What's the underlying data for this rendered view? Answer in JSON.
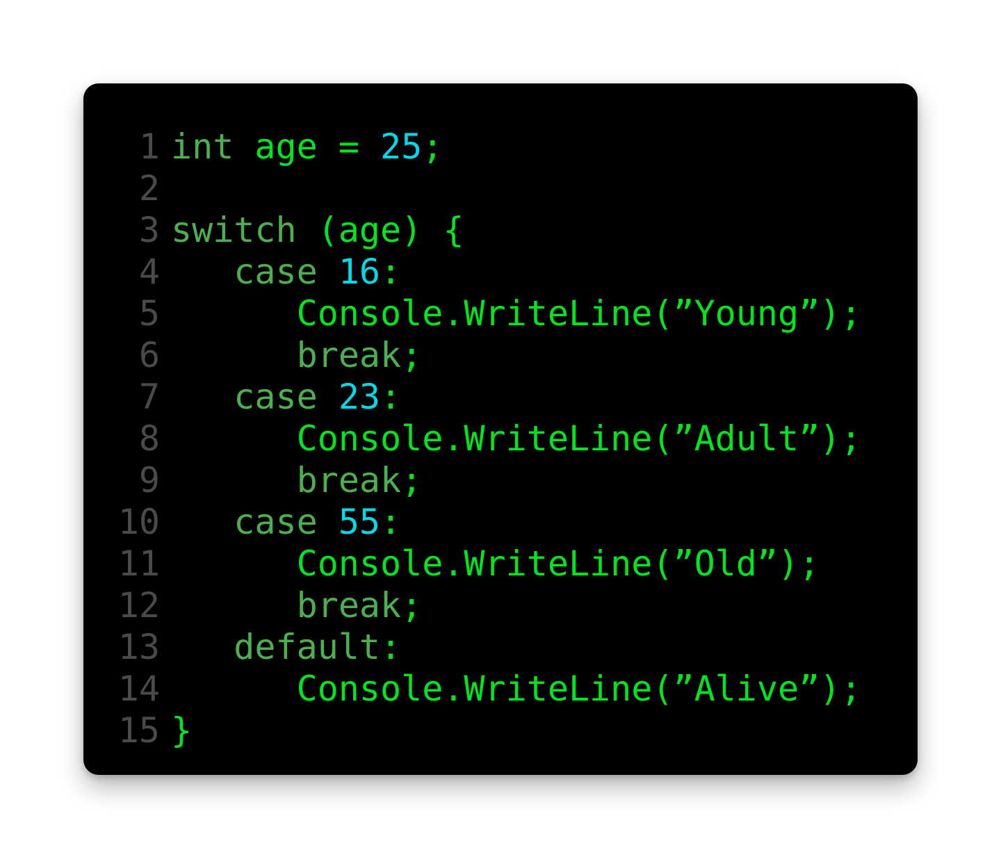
{
  "colors": {
    "background": "#000000",
    "keyword": "#4caf50",
    "identifier": "#00e61e",
    "number": "#00d9e8",
    "line_number": "#4a4a4a"
  },
  "lines": [
    {
      "num": "1",
      "tokens": [
        {
          "t": "int",
          "c": "kw"
        },
        {
          "t": " age = ",
          "c": "id"
        },
        {
          "t": "25",
          "c": "num"
        },
        {
          "t": ";",
          "c": "id"
        }
      ]
    },
    {
      "num": "2",
      "tokens": []
    },
    {
      "num": "3",
      "tokens": [
        {
          "t": "switch",
          "c": "kw"
        },
        {
          "t": " (age) {",
          "c": "id"
        }
      ]
    },
    {
      "num": "4",
      "tokens": [
        {
          "t": "   case ",
          "c": "kw"
        },
        {
          "t": "16",
          "c": "num"
        },
        {
          "t": ":",
          "c": "id"
        }
      ]
    },
    {
      "num": "5",
      "tokens": [
        {
          "t": "      Console.WriteLine(”Young”);",
          "c": "id"
        }
      ]
    },
    {
      "num": "6",
      "tokens": [
        {
          "t": "      break",
          "c": "kw"
        },
        {
          "t": ";",
          "c": "id"
        }
      ]
    },
    {
      "num": "7",
      "tokens": [
        {
          "t": "   case ",
          "c": "kw"
        },
        {
          "t": "23",
          "c": "num"
        },
        {
          "t": ":",
          "c": "id"
        }
      ]
    },
    {
      "num": "8",
      "tokens": [
        {
          "t": "      Console.WriteLine(”Adult”);",
          "c": "id"
        }
      ]
    },
    {
      "num": "9",
      "tokens": [
        {
          "t": "      break",
          "c": "kw"
        },
        {
          "t": ";",
          "c": "id"
        }
      ]
    },
    {
      "num": "10",
      "tokens": [
        {
          "t": "   case ",
          "c": "kw"
        },
        {
          "t": "55",
          "c": "num"
        },
        {
          "t": ":",
          "c": "id"
        }
      ]
    },
    {
      "num": "11",
      "tokens": [
        {
          "t": "      Console.WriteLine(”Old”);",
          "c": "id"
        }
      ]
    },
    {
      "num": "12",
      "tokens": [
        {
          "t": "      break",
          "c": "kw"
        },
        {
          "t": ";",
          "c": "id"
        }
      ]
    },
    {
      "num": "13",
      "tokens": [
        {
          "t": "   default",
          "c": "kw"
        },
        {
          "t": ":",
          "c": "id"
        }
      ]
    },
    {
      "num": "14",
      "tokens": [
        {
          "t": "      Console.WriteLine(”Alive”);",
          "c": "id"
        }
      ]
    },
    {
      "num": "15",
      "tokens": [
        {
          "t": "}",
          "c": "id"
        }
      ]
    }
  ]
}
